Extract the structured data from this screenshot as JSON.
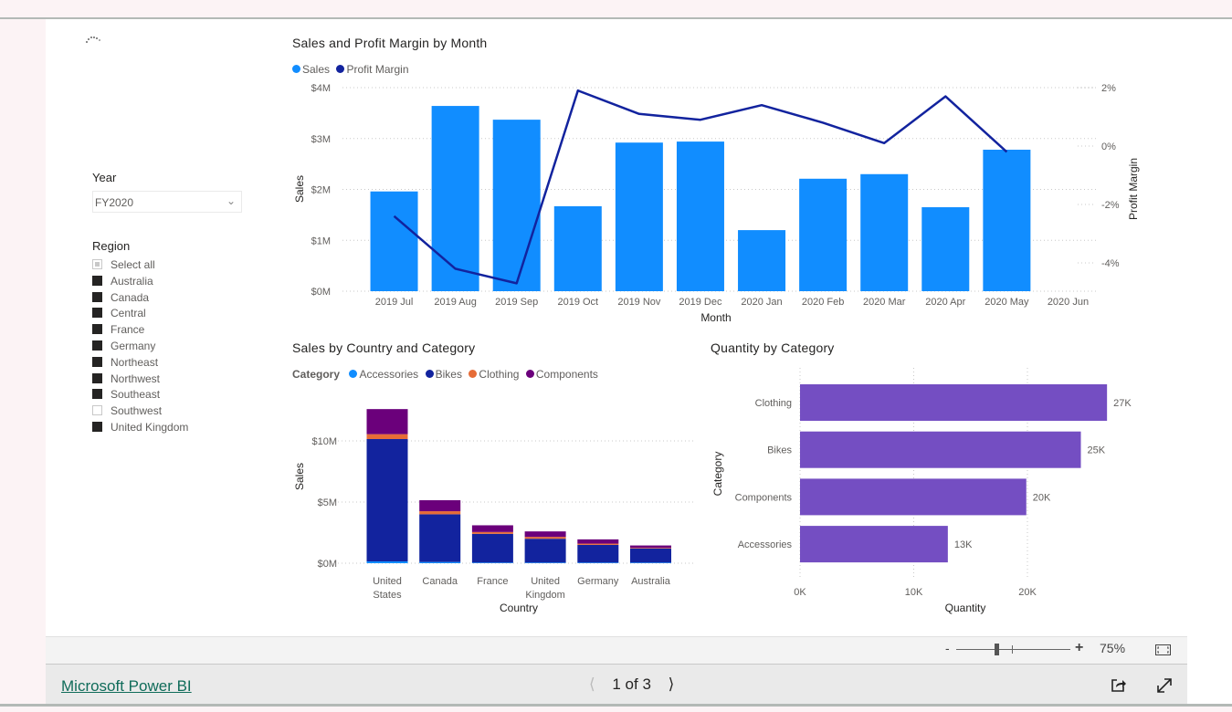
{
  "app": {
    "brand_link": "Microsoft Power BI",
    "page_indicator": "1 of 3",
    "zoom_level": "75%",
    "zoom_minus": "-",
    "zoom_plus": "+"
  },
  "icons": {
    "loading": "loading-spinner-icon",
    "prev": "chevron-left-icon",
    "next": "chevron-right-icon",
    "share": "share-icon",
    "fullscreen": "expand-icon",
    "fit": "fit-to-page-icon"
  },
  "slicers": {
    "year": {
      "label": "Year",
      "value": "FY2020"
    },
    "region": {
      "label": "Region",
      "items": [
        {
          "label": "Select all",
          "state": "partial"
        },
        {
          "label": "Australia",
          "state": "on"
        },
        {
          "label": "Canada",
          "state": "on"
        },
        {
          "label": "Central",
          "state": "on"
        },
        {
          "label": "France",
          "state": "on"
        },
        {
          "label": "Germany",
          "state": "on"
        },
        {
          "label": "Northeast",
          "state": "on"
        },
        {
          "label": "Northwest",
          "state": "on"
        },
        {
          "label": "Southeast",
          "state": "on"
        },
        {
          "label": "Southwest",
          "state": "off"
        },
        {
          "label": "United Kingdom",
          "state": "on"
        }
      ]
    }
  },
  "colors": {
    "sales": "#118dff",
    "profit": "#12239e",
    "accessories": "#118dff",
    "bikes": "#12239e",
    "clothing": "#e66c37",
    "components": "#6b007b",
    "quantity": "#744ec2"
  },
  "chart_data": [
    {
      "type": "bar",
      "title": "Sales and Profit Margin by Month",
      "legend": [
        "Sales",
        "Profit Margin"
      ],
      "legend_position": "top-left",
      "xlabel": "Month",
      "ylabel": "Sales",
      "y2label": "Profit Margin",
      "categories": [
        "2019 Jul",
        "2019 Aug",
        "2019 Sep",
        "2019 Oct",
        "2019 Nov",
        "2019 Dec",
        "2020 Jan",
        "2020 Feb",
        "2020 Mar",
        "2020 Apr",
        "2020 May",
        "2020 Jun"
      ],
      "series": [
        {
          "name": "Sales",
          "type": "bar",
          "axis": "left",
          "values": [
            1.96,
            3.64,
            3.37,
            1.67,
            2.92,
            2.94,
            1.2,
            2.21,
            2.3,
            1.65,
            2.78,
            null
          ]
        },
        {
          "name": "Profit Margin",
          "type": "line",
          "axis": "right",
          "values": [
            -2.4,
            -4.2,
            -4.7,
            1.9,
            1.1,
            0.9,
            1.4,
            0.8,
            0.1,
            1.7,
            -0.2,
            null
          ]
        }
      ],
      "ylim": [
        0,
        4
      ],
      "y2lim": [
        -5,
        2
      ],
      "yticks": [
        "$0M",
        "$1M",
        "$2M",
        "$3M",
        "$4M"
      ],
      "ytick_values": [
        0,
        1,
        2,
        3,
        4
      ],
      "y2ticks": [
        "-4%",
        "-2%",
        "0%",
        "2%"
      ],
      "y2tick_values": [
        -4,
        -2,
        0,
        2
      ],
      "grid": true
    },
    {
      "type": "bar",
      "stacked": true,
      "title": "Sales by Country and Category",
      "legend_title": "Category",
      "legend": [
        "Accessories",
        "Bikes",
        "Clothing",
        "Components"
      ],
      "legend_position": "top-left",
      "xlabel": "Country",
      "ylabel": "Sales",
      "categories": [
        "United States",
        "Canada",
        "France",
        "United Kingdom",
        "Germany",
        "Australia"
      ],
      "series": [
        {
          "name": "Accessories",
          "values": [
            0.15,
            0.1,
            0.05,
            0.05,
            0.05,
            0.05
          ]
        },
        {
          "name": "Bikes",
          "values": [
            10.0,
            3.9,
            2.35,
            1.95,
            1.45,
            1.15
          ]
        },
        {
          "name": "Clothing",
          "values": [
            0.4,
            0.25,
            0.15,
            0.15,
            0.1,
            0.05
          ]
        },
        {
          "name": "Components",
          "values": [
            2.05,
            0.9,
            0.55,
            0.45,
            0.35,
            0.2
          ]
        }
      ],
      "ylim": [
        0,
        13
      ],
      "yticks": [
        "$0M",
        "$5M",
        "$10M"
      ],
      "ytick_values": [
        0,
        5,
        10
      ],
      "grid": true
    },
    {
      "type": "bar",
      "orientation": "horizontal",
      "title": "Quantity by Category",
      "xlabel": "Quantity",
      "ylabel": "Category",
      "categories": [
        "Clothing",
        "Bikes",
        "Components",
        "Accessories"
      ],
      "values": [
        27,
        24.7,
        19.9,
        13
      ],
      "data_labels": [
        "27K",
        "25K",
        "20K",
        "13K"
      ],
      "xlim": [
        0,
        28
      ],
      "xticks": [
        "0K",
        "10K",
        "20K"
      ],
      "xtick_values": [
        0,
        10,
        20
      ],
      "grid": true
    }
  ]
}
